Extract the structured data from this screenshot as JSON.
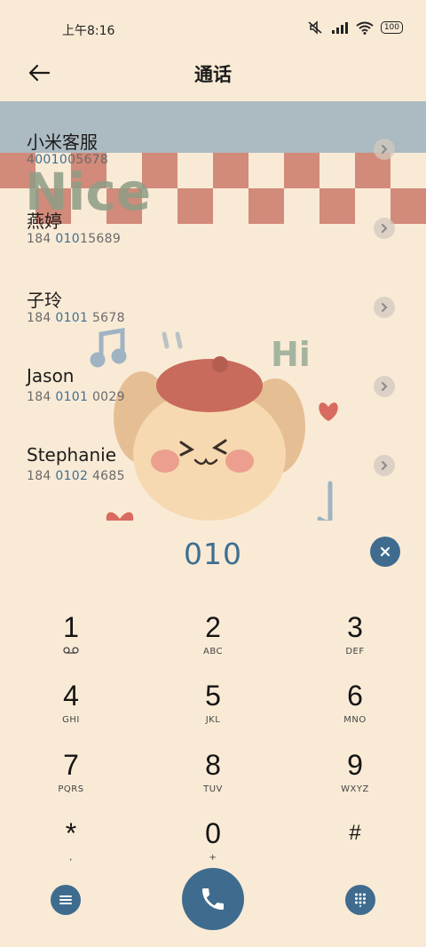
{
  "status_bar": {
    "time": "上午8:16",
    "battery": "100"
  },
  "header": {
    "title": "通话"
  },
  "contacts": [
    {
      "name": "小米客服",
      "number_pre": "4",
      "number_hl": "0010",
      "number_post": "05678"
    },
    {
      "name": "燕婷",
      "number_pre": "184 ",
      "number_hl": "010",
      "number_post": "15689"
    },
    {
      "name": "子玲",
      "number_pre": "184 ",
      "number_hl": "0101",
      "number_post": " 5678"
    },
    {
      "name": "Jason",
      "number_pre": "184 ",
      "number_hl": "0101",
      "number_post": " 0029"
    },
    {
      "name": "Stephanie",
      "number_pre": "184 ",
      "number_hl": "0102",
      "number_post": " 4685"
    }
  ],
  "wallpaper": {
    "text_nice": "Nice",
    "text_hi": "Hi"
  },
  "dialer": {
    "input": "010"
  },
  "keys": [
    {
      "digit": "1",
      "letters": ""
    },
    {
      "digit": "2",
      "letters": "ABC"
    },
    {
      "digit": "3",
      "letters": "DEF"
    },
    {
      "digit": "4",
      "letters": "GHI"
    },
    {
      "digit": "5",
      "letters": "JKL"
    },
    {
      "digit": "6",
      "letters": "MNO"
    },
    {
      "digit": "7",
      "letters": "PQRS"
    },
    {
      "digit": "8",
      "letters": "TUV"
    },
    {
      "digit": "9",
      "letters": "WXYZ"
    },
    {
      "digit": "*",
      "letters": ","
    },
    {
      "digit": "0",
      "letters": "+"
    },
    {
      "digit": "#",
      "letters": ""
    }
  ],
  "colors": {
    "accent": "#3f6c8e",
    "background": "#f9ead6"
  }
}
